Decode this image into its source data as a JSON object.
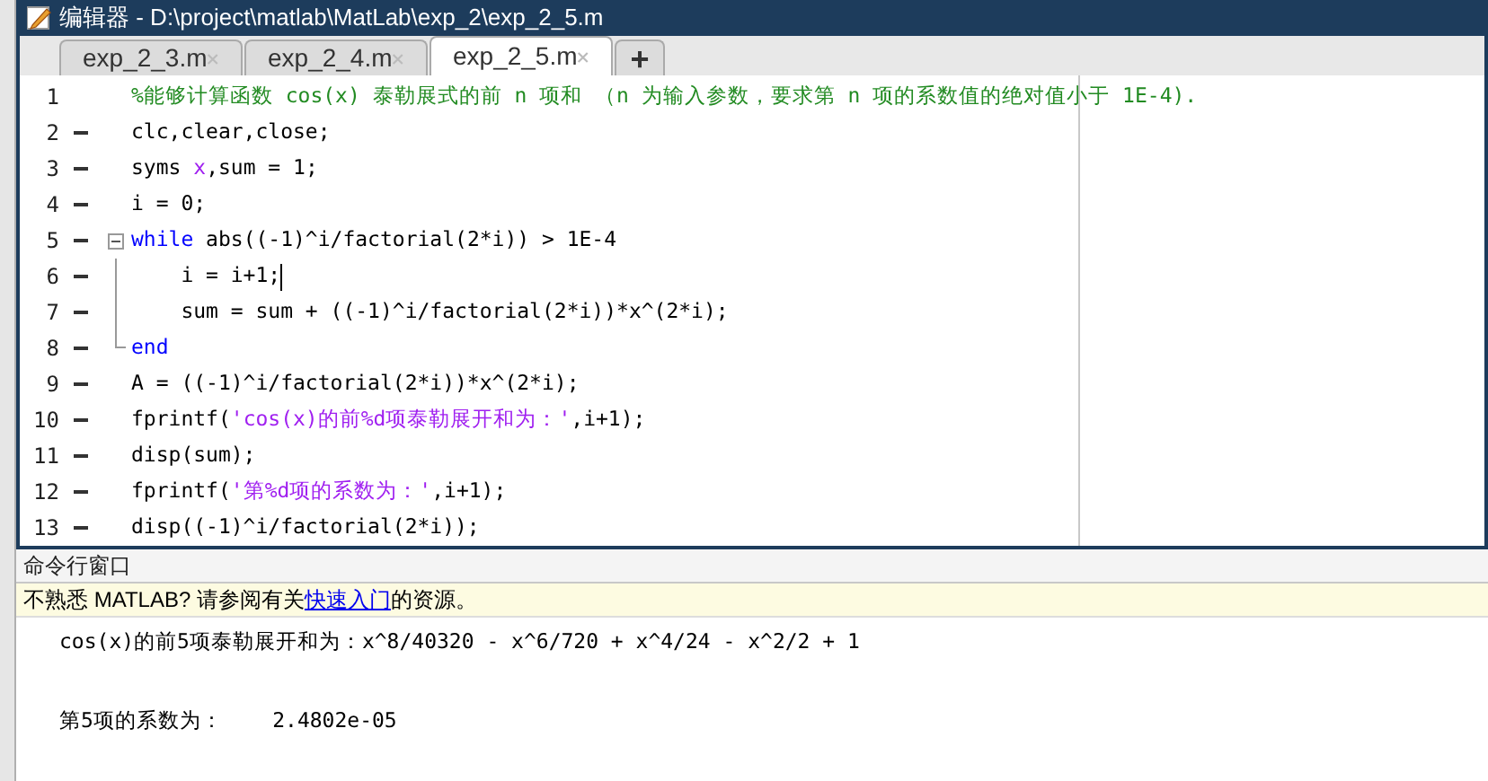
{
  "window": {
    "title": "编辑器 - D:\\project\\matlab\\MatLab\\exp_2\\exp_2_5.m"
  },
  "tabs": [
    {
      "label": "exp_2_3.m",
      "selected": false
    },
    {
      "label": "exp_2_4.m",
      "selected": false
    },
    {
      "label": "exp_2_5.m",
      "selected": true
    }
  ],
  "add_tab": "+",
  "editor": {
    "lines": [
      {
        "number": "1",
        "executable": false,
        "segments": [
          {
            "kind": "comment",
            "text": "%能够计算函数 cos(x) 泰勒展式的前 n 项和 （n 为输入参数，要求第 n 项的系数值的绝对值小于 1E-4)."
          }
        ]
      },
      {
        "number": "2",
        "executable": true,
        "segments": [
          {
            "kind": "plain",
            "text": "clc,clear,close;"
          }
        ]
      },
      {
        "number": "3",
        "executable": true,
        "segments": [
          {
            "kind": "plain",
            "text": "syms "
          },
          {
            "kind": "variable",
            "text": "x"
          },
          {
            "kind": "plain",
            "text": ",sum = 1;"
          }
        ]
      },
      {
        "number": "4",
        "executable": true,
        "segments": [
          {
            "kind": "plain",
            "text": "i = 0;"
          }
        ]
      },
      {
        "number": "5",
        "executable": true,
        "expanded": true,
        "segments": [
          {
            "kind": "keyword",
            "text": "while"
          },
          {
            "kind": "plain",
            "text": " abs((-1)^i/factorial(2*i)) > 1E-4"
          }
        ],
        "children": [
          {
            "number": "6",
            "executable": true,
            "cursor": true,
            "segments": [
              {
                "kind": "plain",
                "text": "    i = i+1;"
              }
            ]
          },
          {
            "number": "7",
            "executable": true,
            "segments": [
              {
                "kind": "plain",
                "text": "    sum = sum + ((-1)^i/factorial(2*i))*x^(2*i);"
              }
            ]
          },
          {
            "number": "8",
            "executable": true,
            "segments": [
              {
                "kind": "keyword",
                "text": "end"
              }
            ]
          }
        ]
      },
      {
        "number": "9",
        "executable": true,
        "segments": [
          {
            "kind": "plain",
            "text": "A = ((-1)^i/factorial(2*i))*x^(2*i);"
          }
        ]
      },
      {
        "number": "10",
        "executable": true,
        "segments": [
          {
            "kind": "plain",
            "text": "fprintf("
          },
          {
            "kind": "string",
            "text": "'cos(x)的前%d项泰勒展开和为：'"
          },
          {
            "kind": "plain",
            "text": ",i+1);"
          }
        ]
      },
      {
        "number": "11",
        "executable": true,
        "segments": [
          {
            "kind": "plain",
            "text": "disp(sum);"
          }
        ]
      },
      {
        "number": "12",
        "executable": true,
        "segments": [
          {
            "kind": "plain",
            "text": "fprintf("
          },
          {
            "kind": "string",
            "text": "'第%d项的系数为：'"
          },
          {
            "kind": "plain",
            "text": ",i+1);"
          }
        ]
      },
      {
        "number": "13",
        "executable": true,
        "segments": [
          {
            "kind": "plain",
            "text": "disp((-1)^i/factorial(2*i));"
          }
        ]
      }
    ]
  },
  "command_window": {
    "title": "命令行窗口",
    "notice": {
      "before": "不熟悉 MATLAB? 请参阅有关",
      "link": "快速入门",
      "after": "的资源。"
    },
    "output": [
      "cos(x)的前5项泰勒展开和为：x^8/40320 - x^6/720 + x^4/24 - x^2/2 + 1",
      "第5项的系数为：    2.4802e-05"
    ]
  }
}
